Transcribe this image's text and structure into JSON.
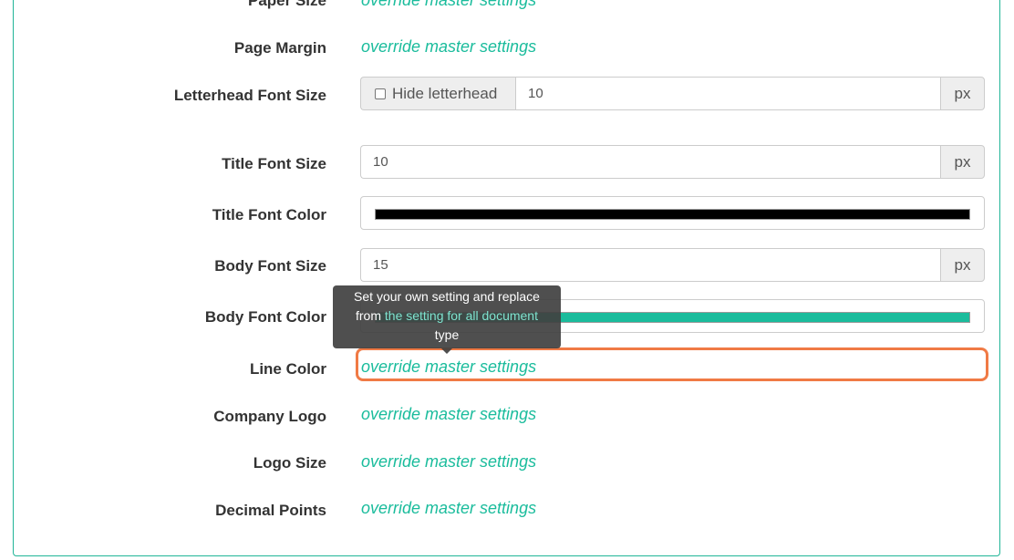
{
  "rows": {
    "paper_size": {
      "label": "Paper Size",
      "value": "override master settings"
    },
    "page_margin": {
      "label": "Page Margin",
      "value": "override master settings"
    },
    "letterhead_font_size": {
      "label": "Letterhead Font Size",
      "checkbox_label": "Hide letterhead",
      "value": "10",
      "unit": "px"
    },
    "title_font_size": {
      "label": "Title Font Size",
      "value": "10",
      "unit": "px"
    },
    "title_font_color": {
      "label": "Title Font Color",
      "color": "#000000"
    },
    "body_font_size": {
      "label": "Body Font Size",
      "value": "15",
      "unit": "px"
    },
    "body_font_color": {
      "label": "Body Font Color",
      "color": "#1abc9c"
    },
    "line_color": {
      "label": "Line Color",
      "value": "override master settings"
    },
    "company_logo": {
      "label": "Company Logo",
      "value": "override master settings"
    },
    "logo_size": {
      "label": "Logo Size",
      "value": "override master settings"
    },
    "decimal_points": {
      "label": "Decimal Points",
      "value": "override master settings"
    }
  },
  "tooltip": {
    "line1": "Set your own setting and replace",
    "line2_prefix": "from",
    "line2_highlight": "the setting for all document",
    "line3": "type"
  },
  "colors": {
    "accent": "#1abc9c",
    "highlight_border": "#f07a45"
  }
}
